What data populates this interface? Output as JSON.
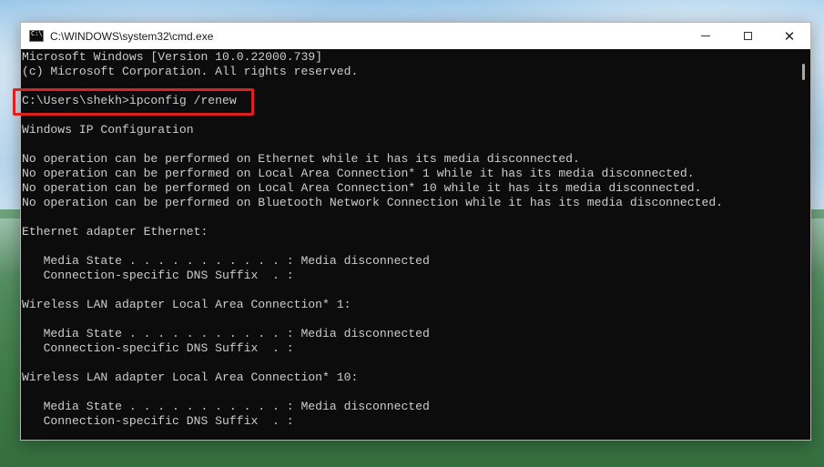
{
  "window": {
    "title": "C:\\WINDOWS\\system32\\cmd.exe",
    "icon": "cmd-icon",
    "controls": {
      "minimize": "minimize-icon",
      "maximize": "maximize-icon",
      "close": "close-icon",
      "close_glyph": "✕"
    }
  },
  "console": {
    "lines": [
      "Microsoft Windows [Version 10.0.22000.739]",
      "(c) Microsoft Corporation. All rights reserved.",
      "",
      "C:\\Users\\shekh>ipconfig /renew",
      "",
      "Windows IP Configuration",
      "",
      "No operation can be performed on Ethernet while it has its media disconnected.",
      "No operation can be performed on Local Area Connection* 1 while it has its media disconnected.",
      "No operation can be performed on Local Area Connection* 10 while it has its media disconnected.",
      "No operation can be performed on Bluetooth Network Connection while it has its media disconnected.",
      "",
      "Ethernet adapter Ethernet:",
      "",
      "   Media State . . . . . . . . . . . : Media disconnected",
      "   Connection-specific DNS Suffix  . :",
      "",
      "Wireless LAN adapter Local Area Connection* 1:",
      "",
      "   Media State . . . . . . . . . . . : Media disconnected",
      "   Connection-specific DNS Suffix  . :",
      "",
      "Wireless LAN adapter Local Area Connection* 10:",
      "",
      "   Media State . . . . . . . . . . . : Media disconnected",
      "   Connection-specific DNS Suffix  . :"
    ]
  },
  "colors": {
    "highlight": "#e01f1f",
    "console_bg": "#0c0c0c",
    "console_text": "#cccccc"
  }
}
